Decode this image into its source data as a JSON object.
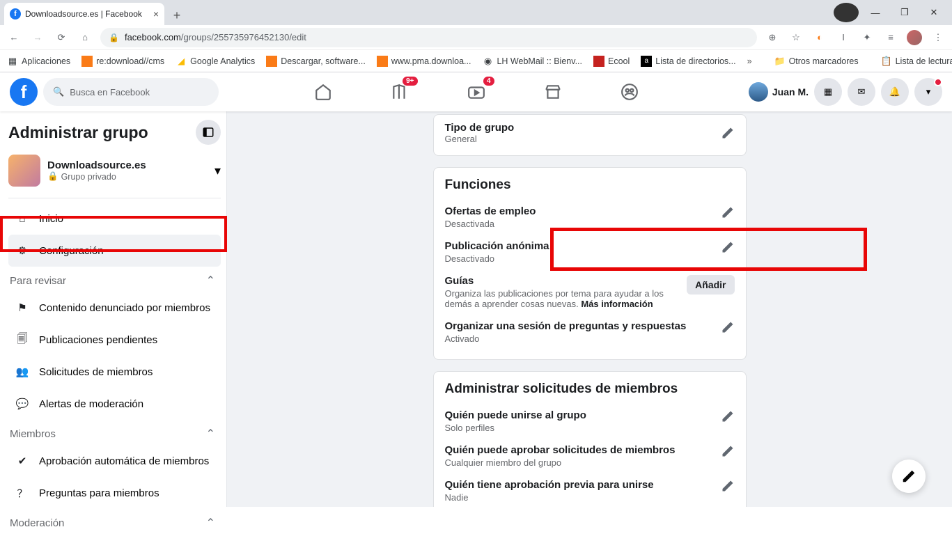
{
  "browser": {
    "tab_title": "Downloadsource.es | Facebook",
    "url_host": "facebook.com",
    "url_path": "/groups/255735976452130/edit",
    "bookmarks": {
      "apps": "Aplicaciones",
      "redownload": "re:download//cms",
      "ga": "Google Analytics",
      "descargar": "Descargar, software...",
      "pma": "www.pma.downloa...",
      "lh": "LH WebMail :: Bienv...",
      "ecool": "Ecool",
      "listdir": "Lista de directorios...",
      "otros": "Otros marcadores",
      "lista": "Lista de lectura"
    }
  },
  "fb": {
    "search_placeholder": "Busca en Facebook",
    "pages_badge": "9+",
    "watch_badge": "4",
    "user_name": "Juan M."
  },
  "sidebar": {
    "title": "Administrar grupo",
    "group_name": "Downloadsource.es",
    "group_privacy": "Grupo privado",
    "inicio": "Inicio",
    "config": "Configuración",
    "para_revisar": "Para revisar",
    "contenido": "Contenido denunciado por miembros",
    "pub_pend": "Publicaciones pendientes",
    "solicitudes": "Solicitudes de miembros",
    "alertas": "Alertas de moderación",
    "miembros_h": "Miembros",
    "aprob_auto": "Aprobación automática de miembros",
    "preguntas": "Preguntas para miembros",
    "moderacion": "Moderación"
  },
  "settings": {
    "tipo_grupo": {
      "label": "Tipo de grupo",
      "value": "General"
    },
    "funciones": "Funciones",
    "ofertas": {
      "label": "Ofertas de empleo",
      "value": "Desactivada"
    },
    "anonima": {
      "label": "Publicación anónima",
      "value": "Desactivado"
    },
    "guias": {
      "label": "Guías",
      "desc": "Organiza las publicaciones por tema para ayudar a los demás a aprender cosas nuevas.",
      "more": "Más información",
      "add": "Añadir"
    },
    "qa": {
      "label": "Organizar una sesión de preguntas y respuestas",
      "value": "Activado"
    },
    "admin_title": "Administrar solicitudes de miembros",
    "quien_unirse": {
      "label": "Quién puede unirse al grupo",
      "value": "Solo perfiles"
    },
    "quien_aprobar": {
      "label": "Quién puede aprobar solicitudes de miembros",
      "value": "Cualquier miembro del grupo"
    },
    "quien_previa": {
      "label": "Quién tiene aprobación previa para unirse",
      "value": "Nadie"
    }
  }
}
